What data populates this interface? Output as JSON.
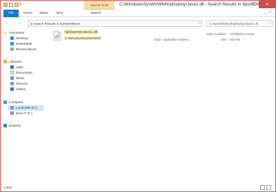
{
  "window": {
    "context_tab": "Search Tools",
    "title": "C:\\Windows\\SysWOW64\\hpDeploy\\Java1.dll - Search Results in SysWOW64",
    "min_label": "–",
    "max_label": "□",
    "close_label": "✕"
  },
  "ribbon": {
    "tabs": [
      "File",
      "Home",
      "Share",
      "View",
      "Search"
    ],
    "expand_label": "⌄",
    "help_label": "?"
  },
  "address": {
    "back": "←",
    "forward": "→",
    "up": "↑",
    "path": "▸  Search Results in SysWOW64  ▸",
    "dropdown": "⌄",
    "refresh": "×",
    "search_value": "C:\\SysWOW64\\hpDeploy\\Java1.dll",
    "search_clear": "×"
  },
  "navpane": {
    "favourites": "Favourites",
    "favourite_items": [
      "Desktop",
      "Downloads",
      "Recent places"
    ],
    "libraries": "Libraries",
    "library_items": [
      "Apps",
      "Documents",
      "Music",
      "Pictures",
      "Videos"
    ],
    "computer": "Computer",
    "computer_items": [
      "Local Disk (C:)",
      "Drive F (F:)"
    ],
    "network": "Network"
  },
  "result": {
    "name": "hpDeploy\\Java1.dll",
    "path": "C:\\Windows\\SysWOW64",
    "type_label": "Type:",
    "type_value": "Application extensi...",
    "date_label": "Date modified:",
    "date_value": "27/08/2013 16:59",
    "size_label": "Size:",
    "size_value": "846 KB"
  },
  "status": {
    "items": "1 item"
  },
  "colors": {
    "accent": "#1979ca",
    "highlight": "#fff59d",
    "close": "#c75050"
  }
}
